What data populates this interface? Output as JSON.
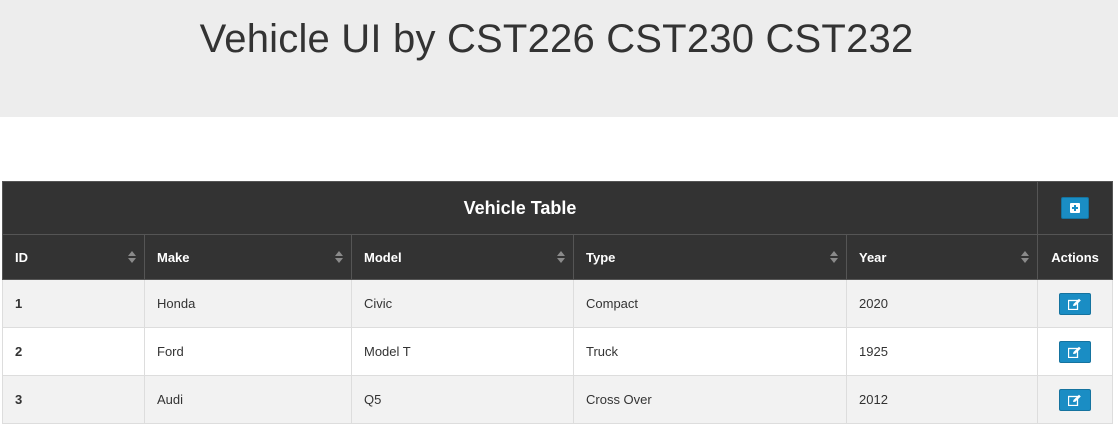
{
  "header": {
    "title": "Vehicle UI by CST226 CST230 CST232"
  },
  "table": {
    "caption": "Vehicle Table",
    "add_icon": "plus-square-icon",
    "edit_icon": "edit-icon",
    "accent_color": "#1a8dc4",
    "header_color": "#333333",
    "columns": [
      "ID",
      "Make",
      "Model",
      "Type",
      "Year",
      "Actions"
    ],
    "rows": [
      {
        "id": "1",
        "make": "Honda",
        "model": "Civic",
        "type": "Compact",
        "year": "2020"
      },
      {
        "id": "2",
        "make": "Ford",
        "model": "Model T",
        "type": "Truck",
        "year": "1925"
      },
      {
        "id": "3",
        "make": "Audi",
        "model": "Q5",
        "type": "Cross Over",
        "year": "2012"
      }
    ]
  }
}
